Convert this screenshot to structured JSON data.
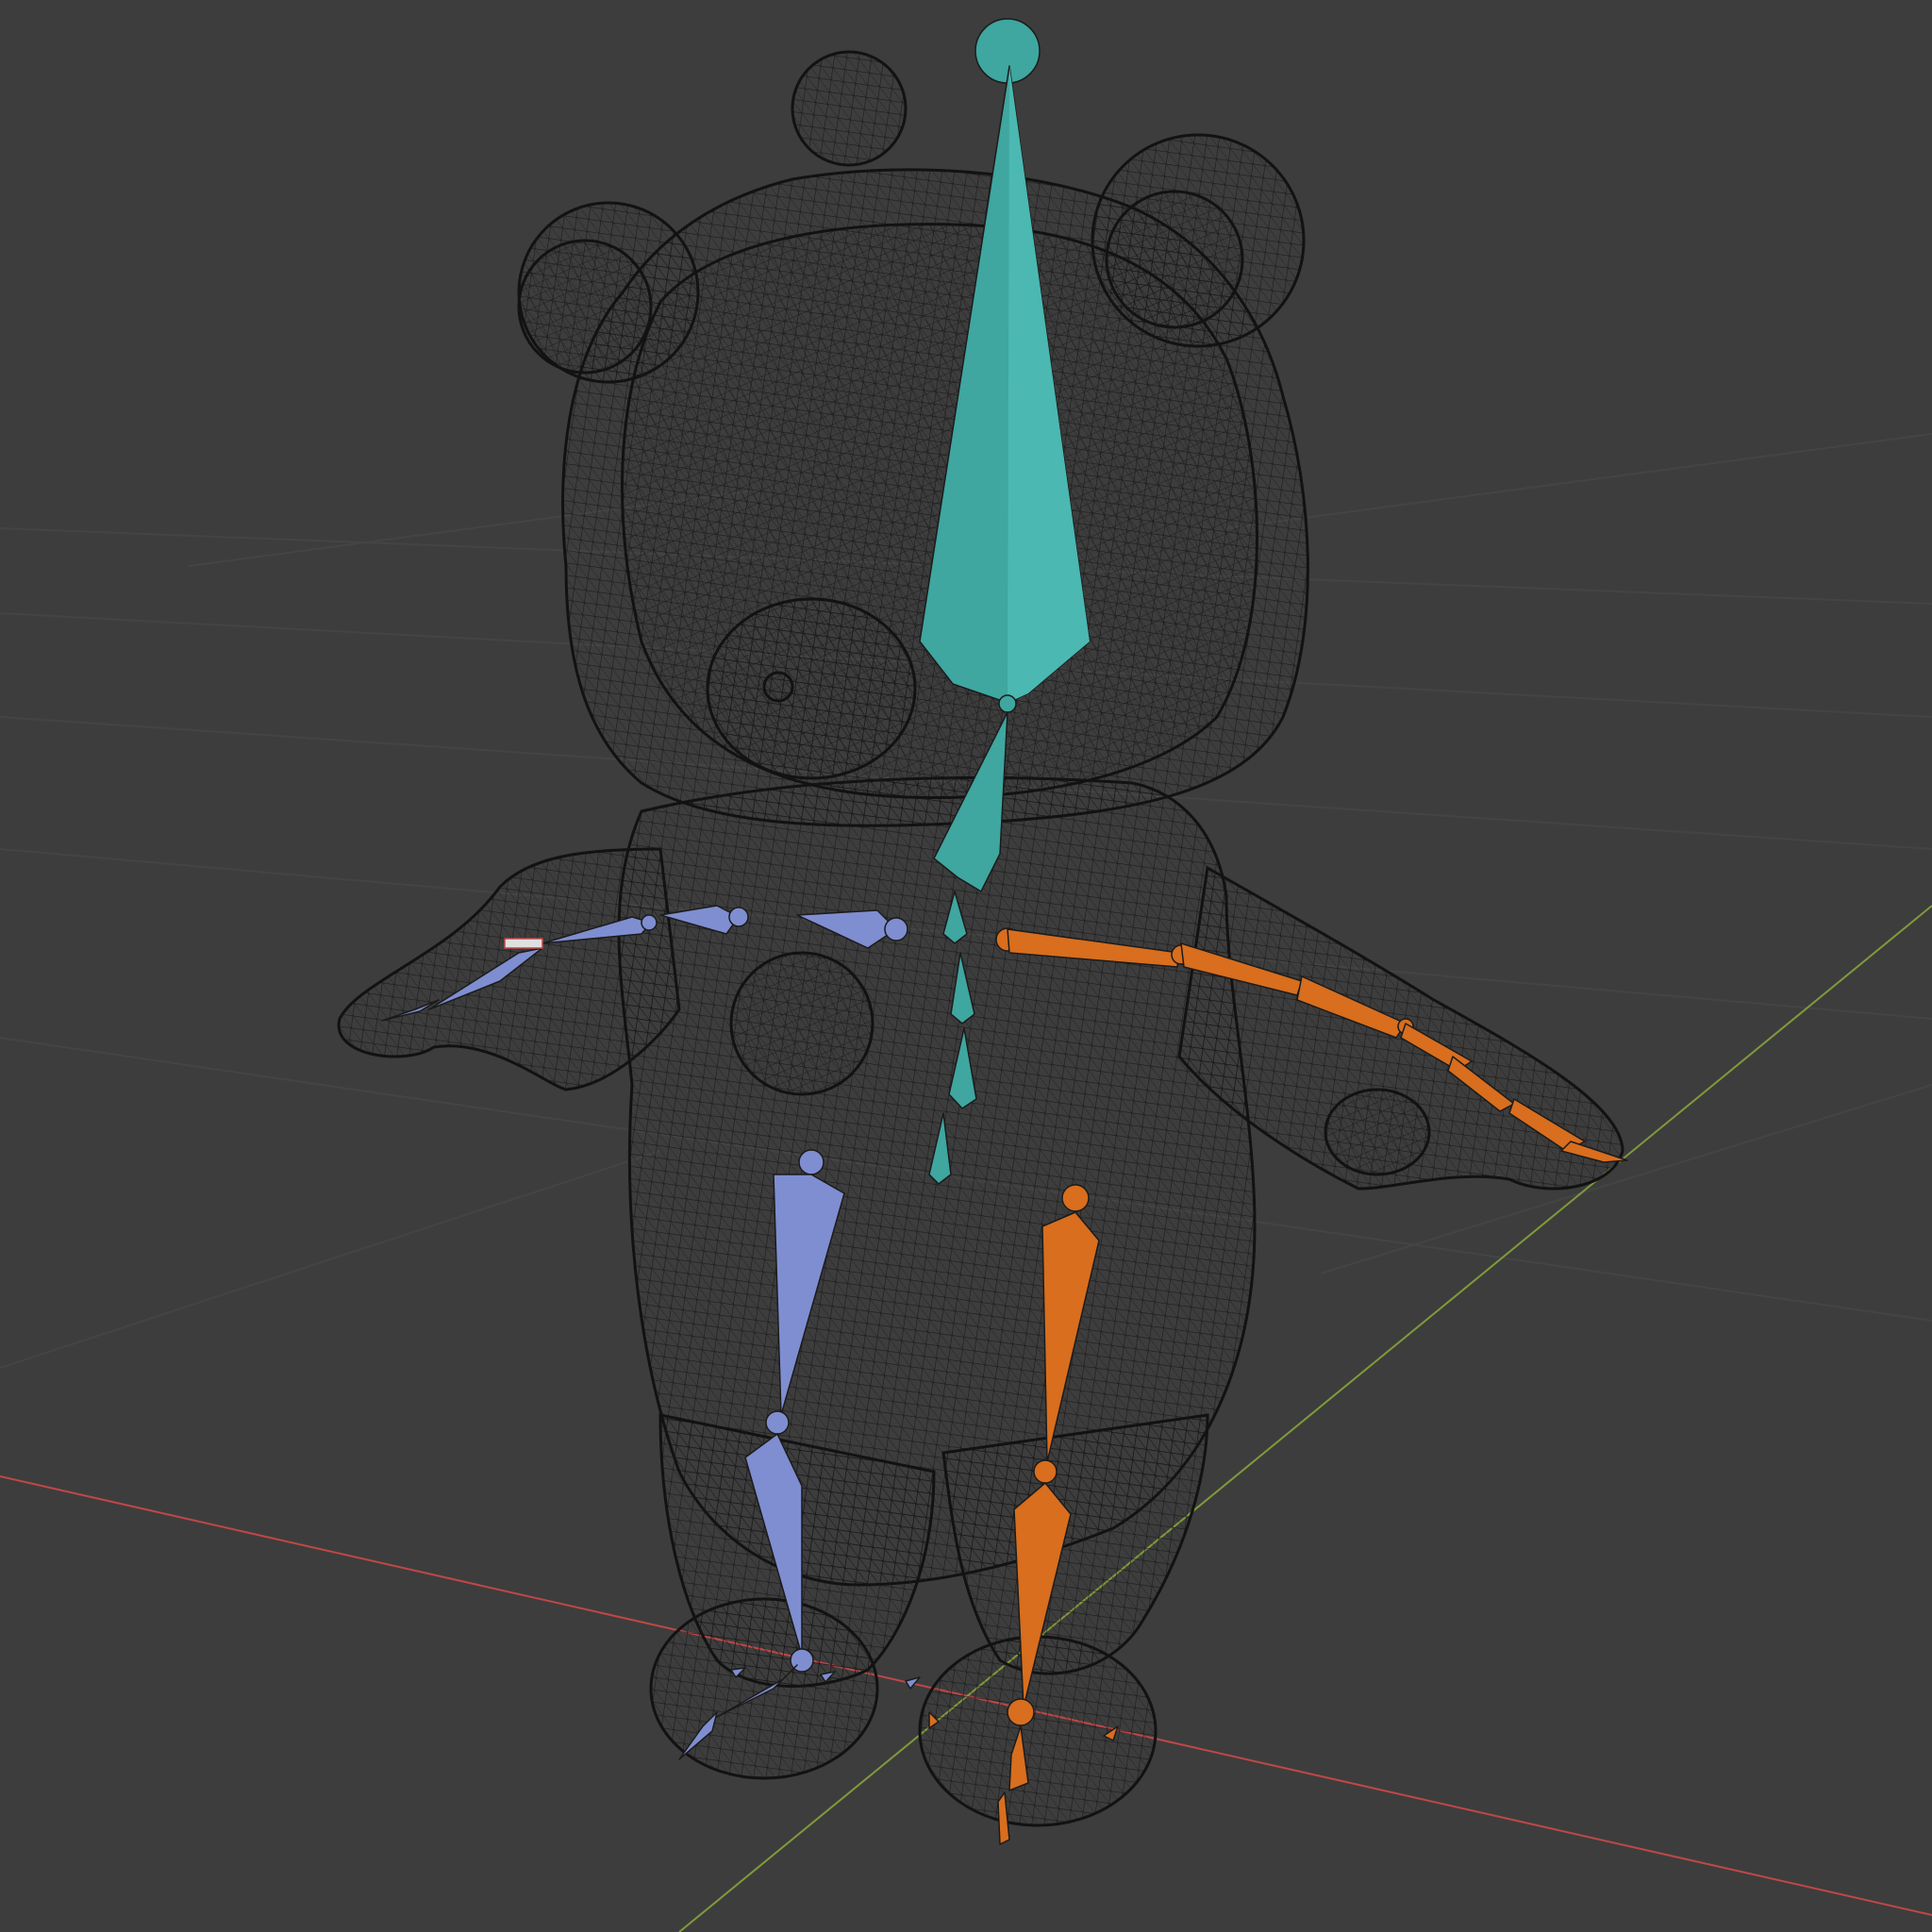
{
  "viewport": {
    "background_color": "#3d3d3d",
    "grid_color": "#4a4a4a",
    "x_axis_color": "#c04747",
    "y_axis_color": "#7f9a3a"
  },
  "mesh": {
    "wire_color": "#151515"
  },
  "armature": {
    "spine_color": "#3fa6a0",
    "left_color": "#7f8ed0",
    "right_color": "#d86e1e"
  }
}
